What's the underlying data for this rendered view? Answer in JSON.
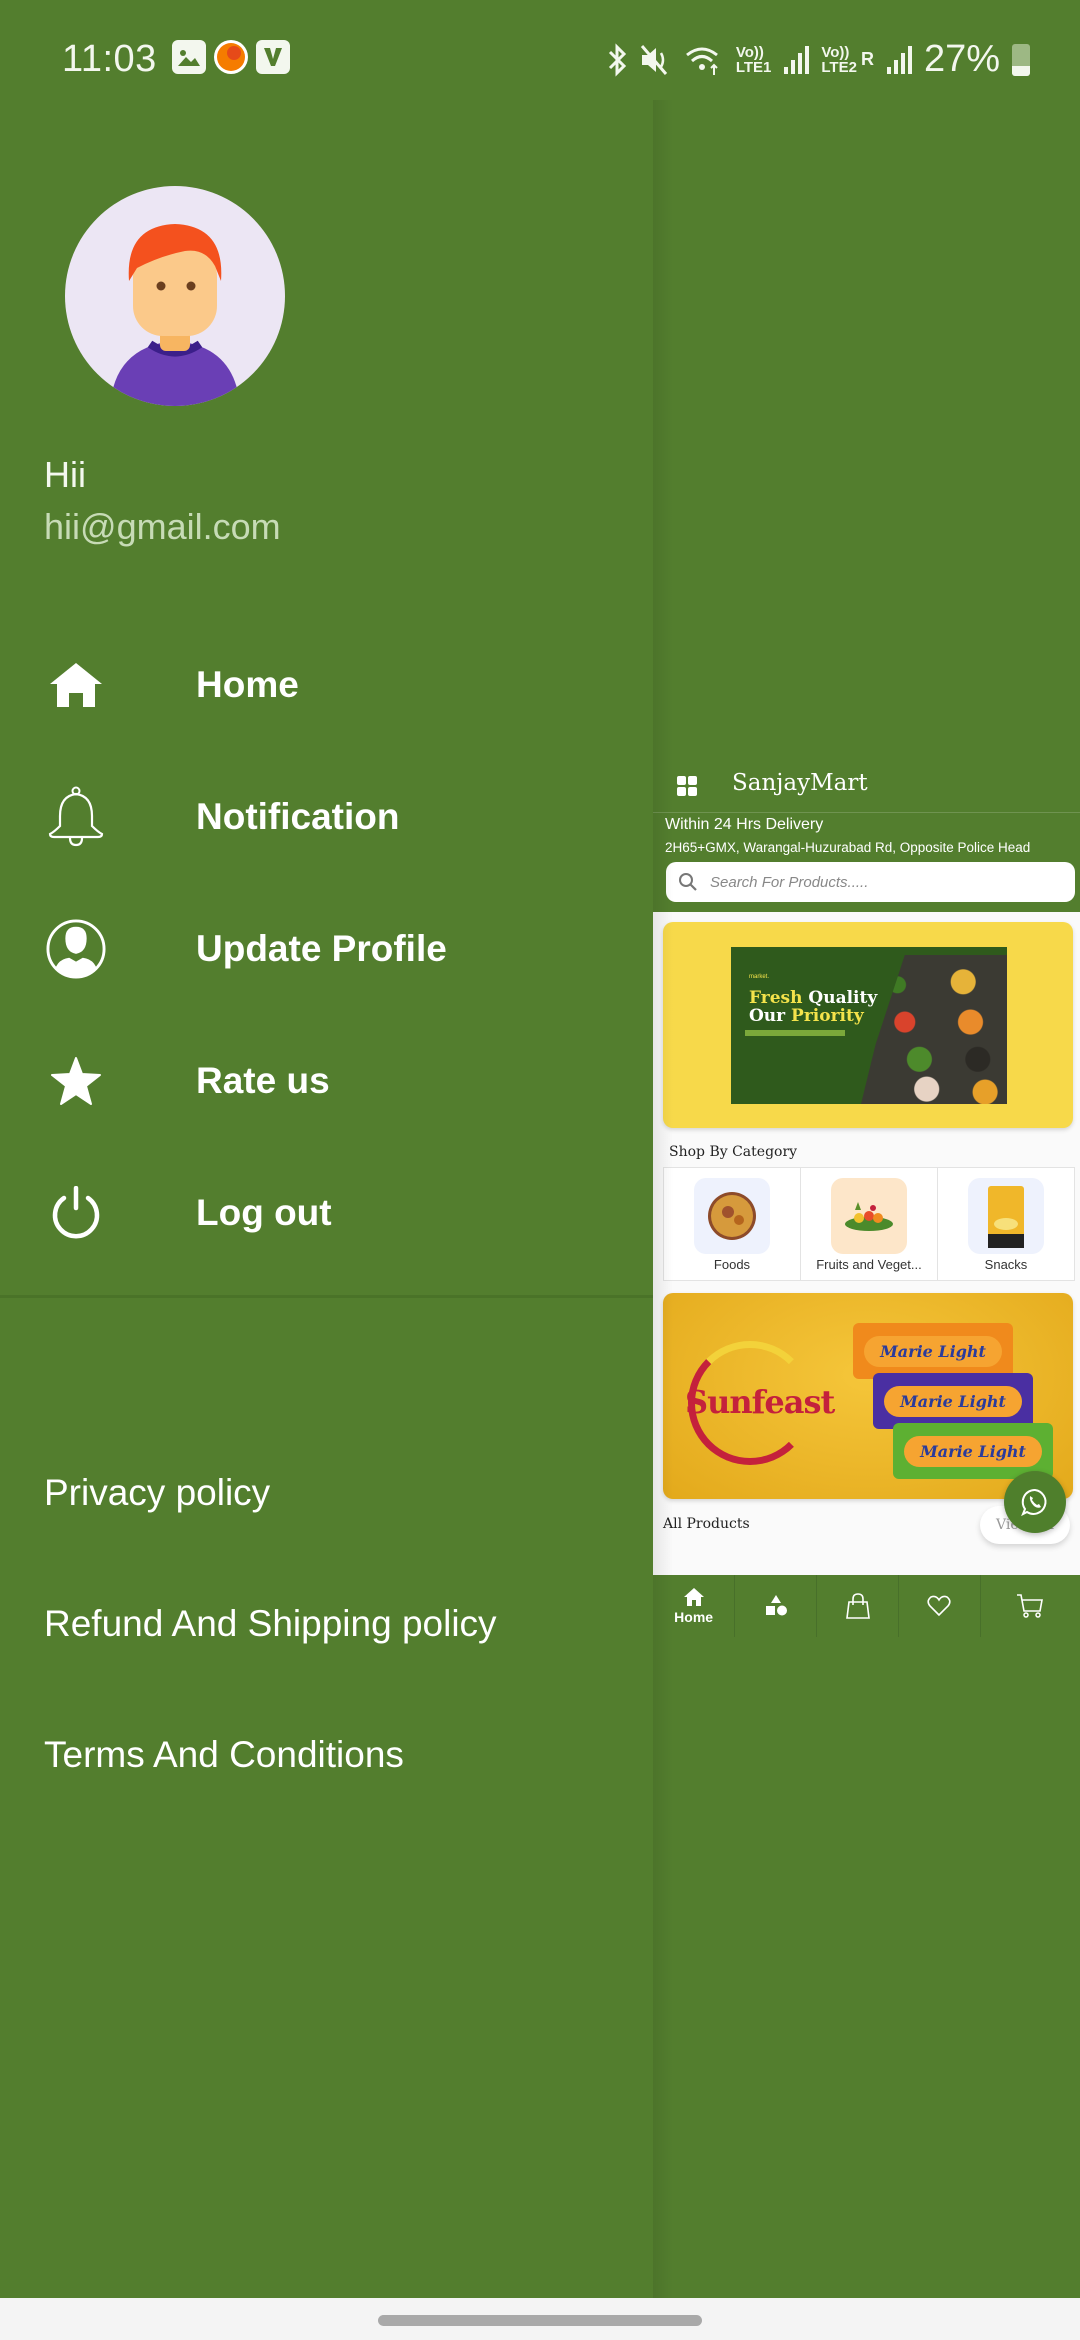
{
  "status_bar": {
    "time": "11:03",
    "notification_icons": [
      "gallery-icon",
      "orange-app-icon",
      "v-app-icon"
    ],
    "system_icons": [
      "bluetooth-icon",
      "mute-icon",
      "wifi-icon",
      "signal-sim1-icon",
      "signal-sim2-icon"
    ],
    "sim1_label_top": "Vo))",
    "sim1_label_bottom": "LTE1",
    "sim2_label_top": "Vo))",
    "sim2_label_bottom": "LTE2",
    "roaming": "R",
    "battery_percent": "27%"
  },
  "drawer": {
    "user": {
      "name": "Hii",
      "email": "hii@gmail.com"
    },
    "menu_items": [
      {
        "label": "Home",
        "icon": "home-icon"
      },
      {
        "label": "Notification",
        "icon": "bell-icon"
      },
      {
        "label": "Update Profile",
        "icon": "user-circle-icon"
      },
      {
        "label": "Rate us",
        "icon": "star-icon"
      },
      {
        "label": "Log out",
        "icon": "power-icon"
      }
    ],
    "policy_links": [
      {
        "label": "Privacy policy"
      },
      {
        "label": "Refund And Shipping policy"
      },
      {
        "label": "Terms And Conditions"
      }
    ]
  },
  "app": {
    "title": "SanjayMart",
    "delivery_text": "Within 24 Hrs Delivery",
    "address": "2H65+GMX, Warangal-Huzurabad Rd, Opposite Police Head",
    "search_placeholder": "Search For Products.....",
    "banner1": {
      "brand": "market.",
      "title_line1_a": "Fresh",
      "title_line1_b": " Quality",
      "title_line2_a": "Our ",
      "title_line2_b": "Priority"
    },
    "shop_by_category_title": "Shop By Category",
    "categories": [
      {
        "label": "Foods"
      },
      {
        "label": "Fruits and Veget..."
      },
      {
        "label": "Snacks"
      }
    ],
    "banner2": {
      "brand": "Sunfeast",
      "product": "Marie Light"
    },
    "all_products_title": "All Products",
    "view_all_label": "View All",
    "bottom_nav": [
      {
        "label": "Home",
        "icon": "home-icon",
        "active": true
      },
      {
        "label": "",
        "icon": "categories-icon",
        "active": false
      },
      {
        "label": "",
        "icon": "shopping-bag-icon",
        "active": false
      },
      {
        "label": "",
        "icon": "heart-icon",
        "active": false
      },
      {
        "label": "",
        "icon": "cart-icon",
        "active": false
      }
    ]
  },
  "colors": {
    "primary_green": "#537e2e",
    "banner_yellow": "#f7d94a",
    "white": "#ffffff"
  }
}
